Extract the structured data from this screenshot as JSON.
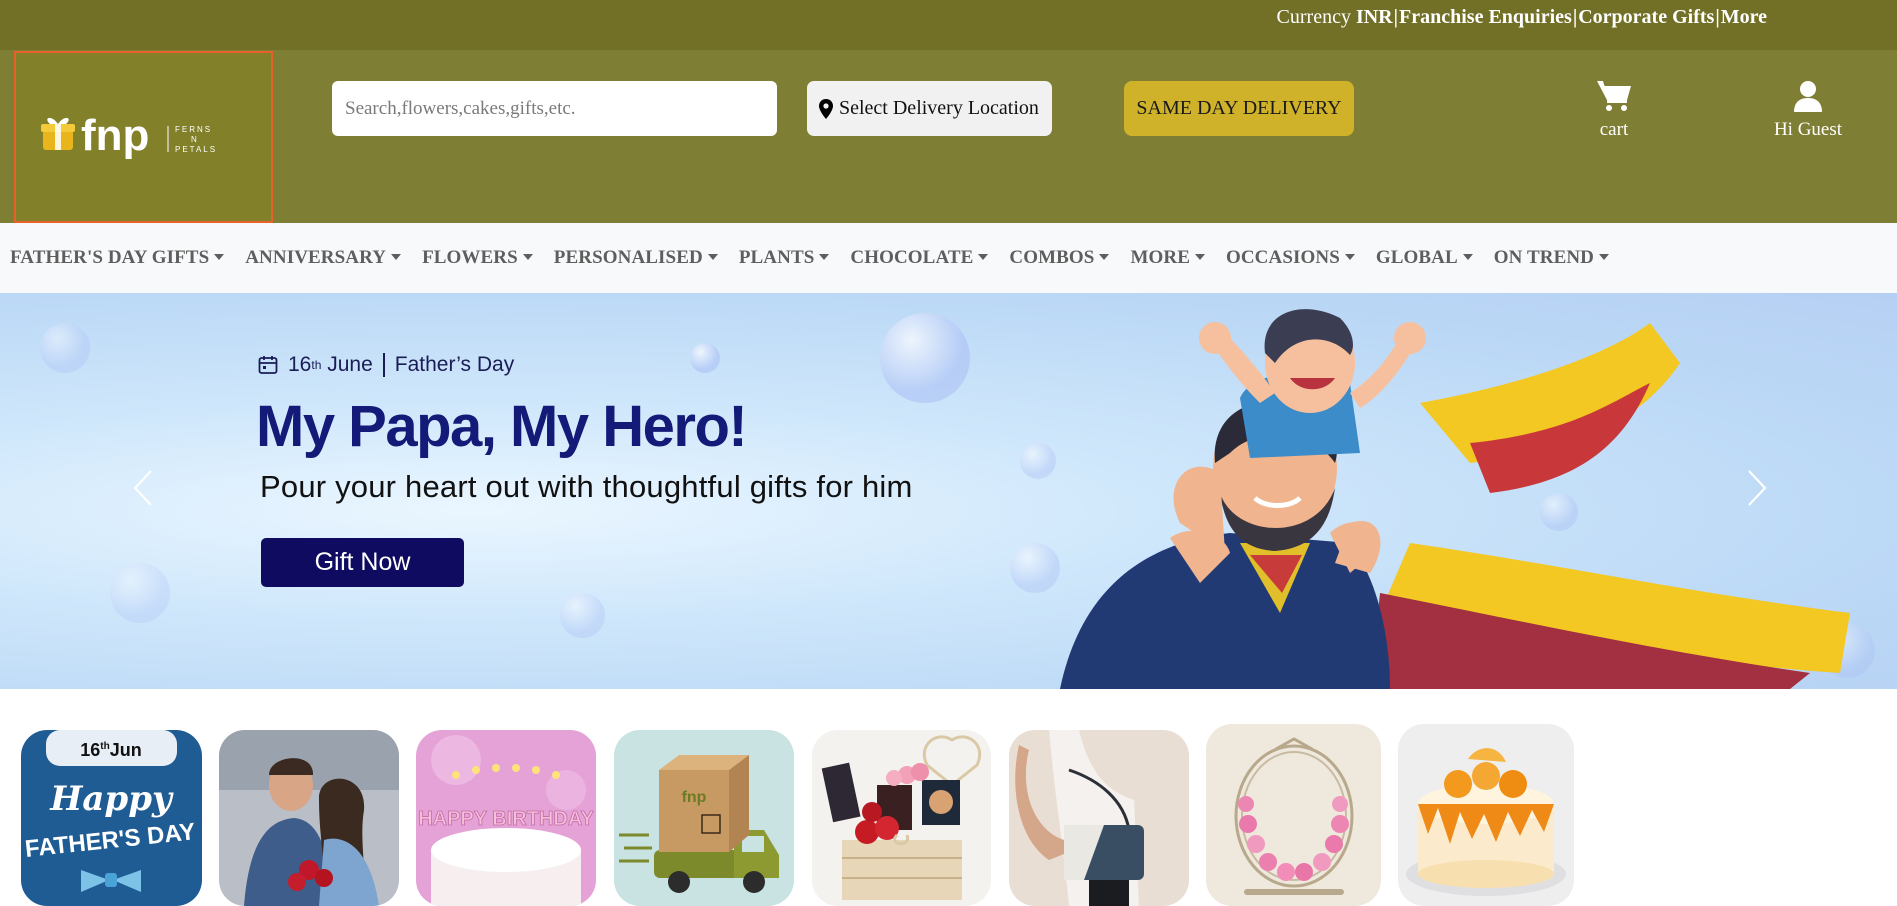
{
  "topbar": {
    "currency_label": "Currency ",
    "currency_value": "INR",
    "franchise": "Franchise Enquiries",
    "corporate": "Corporate Gifts",
    "more": "More",
    "separator": "|"
  },
  "header": {
    "logo": {
      "brand": "fnp",
      "tagline_lines": [
        "FERNS",
        "N",
        "PETALS"
      ]
    },
    "search": {
      "placeholder": "Search,flowers,cakes,gifts,etc.",
      "value": ""
    },
    "location_label": "Select Delivery Location",
    "same_day_label": "SAME DAY DELIVERY",
    "cart_label": "cart",
    "user_label": "Hi Guest"
  },
  "nav": {
    "items": [
      "FATHER'S DAY GIFTS",
      "ANNIVERSARY",
      "FLOWERS",
      "PERSONALISED",
      "PLANTS",
      "CHOCOLATE",
      "COMBOS",
      "MORE",
      "OCCASIONS",
      "GLOBAL",
      "ON TREND"
    ]
  },
  "banner": {
    "date_day": "16",
    "date_suffix": "th",
    "date_month": "June",
    "date_occasion": "Father’s Day",
    "title": "My Papa, My Hero!",
    "subtitle": "Pour your heart out with thoughtful gifts for him",
    "cta_label": "Gift Now"
  },
  "categories": {
    "fathers_day_tile": {
      "date_day": "16",
      "date_suffix": "th",
      "date_month": "Jun",
      "line1": "Happy",
      "line2": "FATHER'S DAY"
    },
    "birthday_candles_text": "HAPPY BIRTHDAY",
    "truck_brand": "fnp"
  },
  "colors": {
    "topbar": "#727027",
    "header": "#7f7e35",
    "accent_gold": "#cfb22a",
    "banner_title": "#141a78",
    "cta_bg": "#0e0b60"
  }
}
